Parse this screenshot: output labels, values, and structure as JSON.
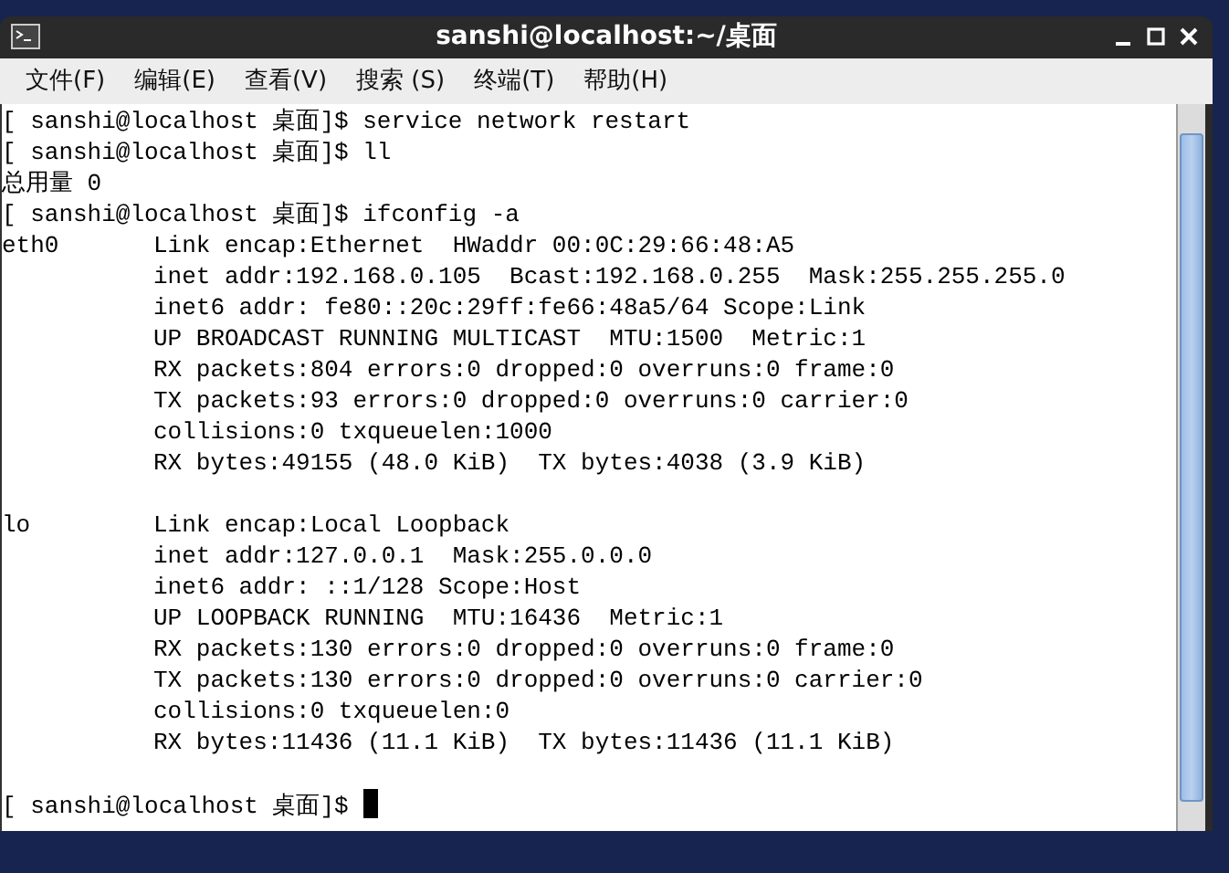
{
  "window": {
    "title": "sanshi@localhost:~/桌面"
  },
  "menu": [
    "文件(F)",
    "编辑(E)",
    "查看(V)",
    "搜索 (S)",
    "终端(T)",
    "帮助(H)"
  ],
  "terminal": {
    "cursor": true,
    "lines": [
      {
        "kind": "text",
        "text": "[ sanshi@localhost 桌面]$ service network restart"
      },
      {
        "kind": "text",
        "text": "[ sanshi@localhost 桌面]$ ll"
      },
      {
        "kind": "text",
        "text": "总用量 0"
      },
      {
        "kind": "text",
        "text": "[ sanshi@localhost 桌面]$ ifconfig -a"
      },
      {
        "kind": "iface",
        "iface": "eth0",
        "text": "Link encap:Ethernet  HWaddr 00:0C:29:66:48:A5"
      },
      {
        "kind": "iface",
        "text": "inet addr:192.168.0.105  Bcast:192.168.0.255  Mask:255.255.255.0"
      },
      {
        "kind": "iface",
        "text": "inet6 addr: fe80::20c:29ff:fe66:48a5/64 Scope:Link"
      },
      {
        "kind": "iface",
        "text": "UP BROADCAST RUNNING MULTICAST  MTU:1500  Metric:1"
      },
      {
        "kind": "iface",
        "text": "RX packets:804 errors:0 dropped:0 overruns:0 frame:0"
      },
      {
        "kind": "iface",
        "text": "TX packets:93 errors:0 dropped:0 overruns:0 carrier:0"
      },
      {
        "kind": "iface",
        "text": "collisions:0 txqueuelen:1000"
      },
      {
        "kind": "iface",
        "text": "RX bytes:49155 (48.0 KiB)  TX bytes:4038 (3.9 KiB)"
      },
      {
        "kind": "blank"
      },
      {
        "kind": "iface",
        "iface": "lo",
        "text": "Link encap:Local Loopback"
      },
      {
        "kind": "iface",
        "text": "inet addr:127.0.0.1  Mask:255.0.0.0"
      },
      {
        "kind": "iface",
        "text": "inet6 addr: ::1/128 Scope:Host"
      },
      {
        "kind": "iface",
        "text": "UP LOOPBACK RUNNING  MTU:16436  Metric:1"
      },
      {
        "kind": "iface",
        "text": "RX packets:130 errors:0 dropped:0 overruns:0 frame:0"
      },
      {
        "kind": "iface",
        "text": "TX packets:130 errors:0 dropped:0 overruns:0 carrier:0"
      },
      {
        "kind": "iface",
        "text": "collisions:0 txqueuelen:0"
      },
      {
        "kind": "iface",
        "text": "RX bytes:11436 (11.1 KiB)  TX bytes:11436 (11.1 KiB)"
      },
      {
        "kind": "blank"
      },
      {
        "kind": "text",
        "text": "[ sanshi@localhost 桌面]$ "
      }
    ]
  }
}
